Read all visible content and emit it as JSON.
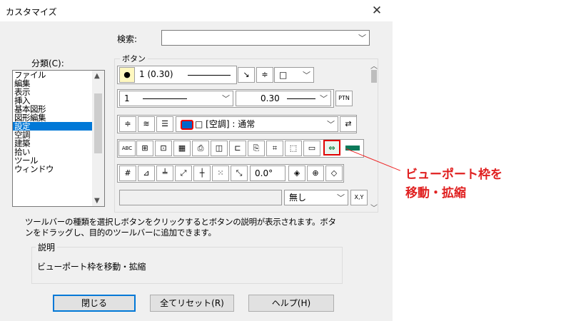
{
  "window": {
    "title": "カスタマイズ",
    "close_glyph": "✕"
  },
  "search": {
    "label": "検索:",
    "value": ""
  },
  "category": {
    "label": "分類(C):",
    "items": [
      "ファイル",
      "編集",
      "表示",
      "挿入",
      "基本図形",
      "図形編集",
      "設定",
      "空調",
      "建築",
      "拾い",
      "ツール",
      "ウィンドウ"
    ],
    "selected": "設定"
  },
  "buttons_group": {
    "label": "ボタン"
  },
  "row1": {
    "pen_value": "1 (0.30)",
    "shape_glyph": "□"
  },
  "row2": {
    "linetype_value": "1",
    "width_value": "0.30",
    "ptn_label": "PTN"
  },
  "row3": {
    "layer_value": "□ [空調] : 通常"
  },
  "row5": {
    "angle_value": "0.0°"
  },
  "row6": {
    "value": "",
    "style_value": "無し",
    "xy_label": "X,Y"
  },
  "description": {
    "text": "ツールバーの種類を選択しボタンをクリックするとボタンの説明が表示されます。ボタンをドラッグし、目的のツールバーに追加できます。"
  },
  "explanation": {
    "label": "説明",
    "text": "ビューポート枠を移動・拡縮"
  },
  "footer": {
    "close_label": "閉じる",
    "reset_label": "全てリセット(R)",
    "help_label": "ヘルプ(H)"
  },
  "annotation": {
    "line1": "ビューポート枠を",
    "line2": "移動・拡縮",
    "color": "#e02020"
  },
  "icons": [
    "pen-icon",
    "line-icon",
    "snap-icon",
    "layer-icon",
    "print-icon",
    "viewport-move-icon",
    "angle-icon"
  ]
}
